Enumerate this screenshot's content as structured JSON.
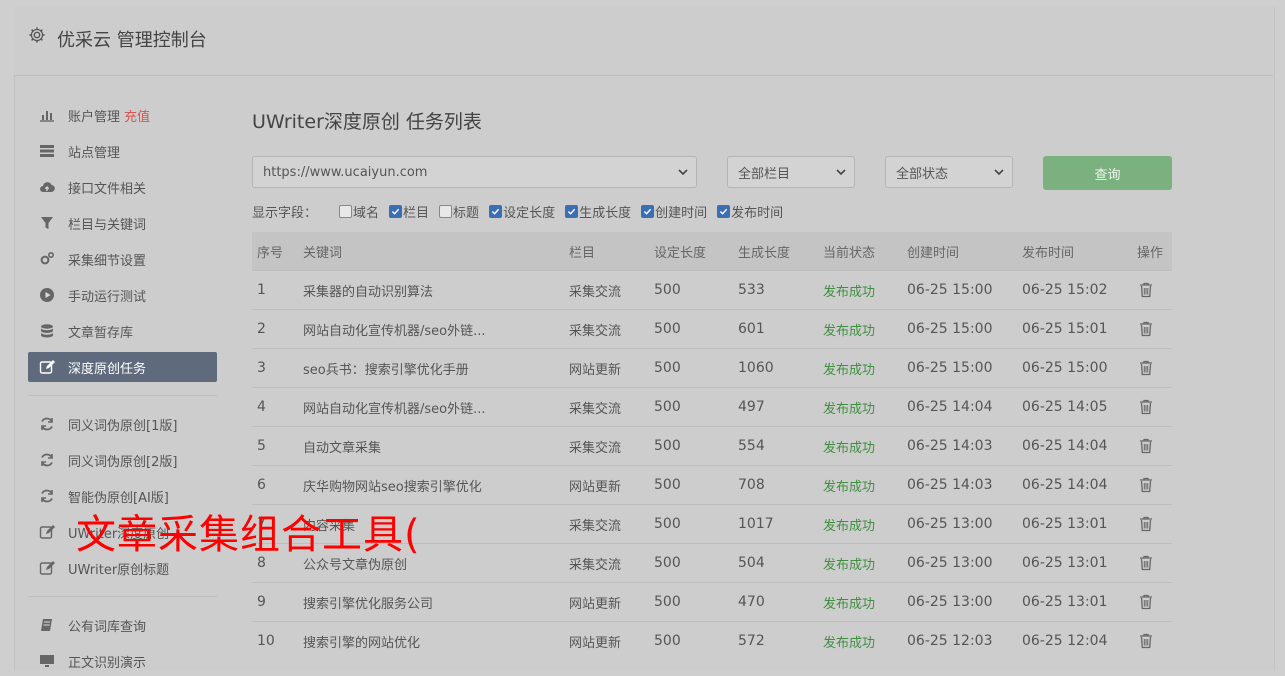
{
  "app": {
    "title": "优采云 管理控制台"
  },
  "sidebar": {
    "items": [
      {
        "label": "账户管理",
        "extra": "充值",
        "icon": "bar-chart-icon"
      },
      {
        "label": "站点管理",
        "icon": "server-icon"
      },
      {
        "label": "接口文件相关",
        "icon": "cloud-upload-icon"
      },
      {
        "label": "栏目与关键词",
        "icon": "filter-icon"
      },
      {
        "label": "采集细节设置",
        "icon": "gears-icon"
      },
      {
        "label": "手动运行测试",
        "icon": "play-circle-icon"
      },
      {
        "label": "文章暂存库",
        "icon": "database-icon"
      },
      {
        "label": "深度原创任务",
        "icon": "edit-icon",
        "active": true
      },
      {
        "label": "同义词伪原创[1版]",
        "icon": "refresh-icon"
      },
      {
        "label": "同义词伪原创[2版]",
        "icon": "refresh-icon"
      },
      {
        "label": "智能伪原创[AI版]",
        "icon": "refresh-icon"
      },
      {
        "label": "UWriter深度原创",
        "icon": "edit-icon"
      },
      {
        "label": "UWriter原创标题",
        "icon": "edit-icon"
      },
      {
        "label": "公有词库查询",
        "icon": "book-icon"
      },
      {
        "label": "正文识别演示",
        "icon": "monitor-icon"
      }
    ]
  },
  "main": {
    "title": "UWriter深度原创 任务列表",
    "filters": {
      "site": "https://www.ucaiyun.com",
      "category": "全部栏目",
      "status": "全部状态",
      "query_label": "查询"
    },
    "fields": {
      "label": "显示字段：",
      "options": [
        {
          "label": "域名",
          "checked": false
        },
        {
          "label": "栏目",
          "checked": true
        },
        {
          "label": "标题",
          "checked": false
        },
        {
          "label": "设定长度",
          "checked": true
        },
        {
          "label": "生成长度",
          "checked": true
        },
        {
          "label": "创建时间",
          "checked": true
        },
        {
          "label": "发布时间",
          "checked": true
        }
      ]
    },
    "table": {
      "headers": [
        "序号",
        "关键词",
        "栏目",
        "设定长度",
        "生成长度",
        "当前状态",
        "创建时间",
        "发布时间",
        "操作"
      ],
      "rows": [
        [
          "1",
          "采集器的自动识别算法",
          "采集交流",
          "500",
          "533",
          "发布成功",
          "06-25 15:00",
          "06-25 15:02"
        ],
        [
          "2",
          "网站自动化宣传机器/seo外链...",
          "采集交流",
          "500",
          "601",
          "发布成功",
          "06-25 15:00",
          "06-25 15:01"
        ],
        [
          "3",
          "seo兵书：搜索引擎优化手册",
          "网站更新",
          "500",
          "1060",
          "发布成功",
          "06-25 15:00",
          "06-25 15:00"
        ],
        [
          "4",
          "网站自动化宣传机器/seo外链...",
          "采集交流",
          "500",
          "497",
          "发布成功",
          "06-25 14:04",
          "06-25 14:05"
        ],
        [
          "5",
          "自动文章采集",
          "采集交流",
          "500",
          "554",
          "发布成功",
          "06-25 14:03",
          "06-25 14:04"
        ],
        [
          "6",
          "庆华购物网站seo搜索引擎优化",
          "网站更新",
          "500",
          "708",
          "发布成功",
          "06-25 14:03",
          "06-25 14:04"
        ],
        [
          "7",
          "内容采集",
          "采集交流",
          "500",
          "1017",
          "发布成功",
          "06-25 13:00",
          "06-25 13:01"
        ],
        [
          "8",
          "公众号文章伪原创",
          "采集交流",
          "500",
          "504",
          "发布成功",
          "06-25 13:00",
          "06-25 13:01"
        ],
        [
          "9",
          "搜索引擎优化服务公司",
          "网站更新",
          "500",
          "470",
          "发布成功",
          "06-25 13:00",
          "06-25 13:01"
        ],
        [
          "10",
          "搜索引擎的网站优化",
          "网站更新",
          "500",
          "572",
          "发布成功",
          "06-25 12:03",
          "06-25 12:04"
        ]
      ],
      "delete_icon": "trash-icon"
    }
  },
  "overlay": {
    "text": "文章采集组合工具("
  }
}
